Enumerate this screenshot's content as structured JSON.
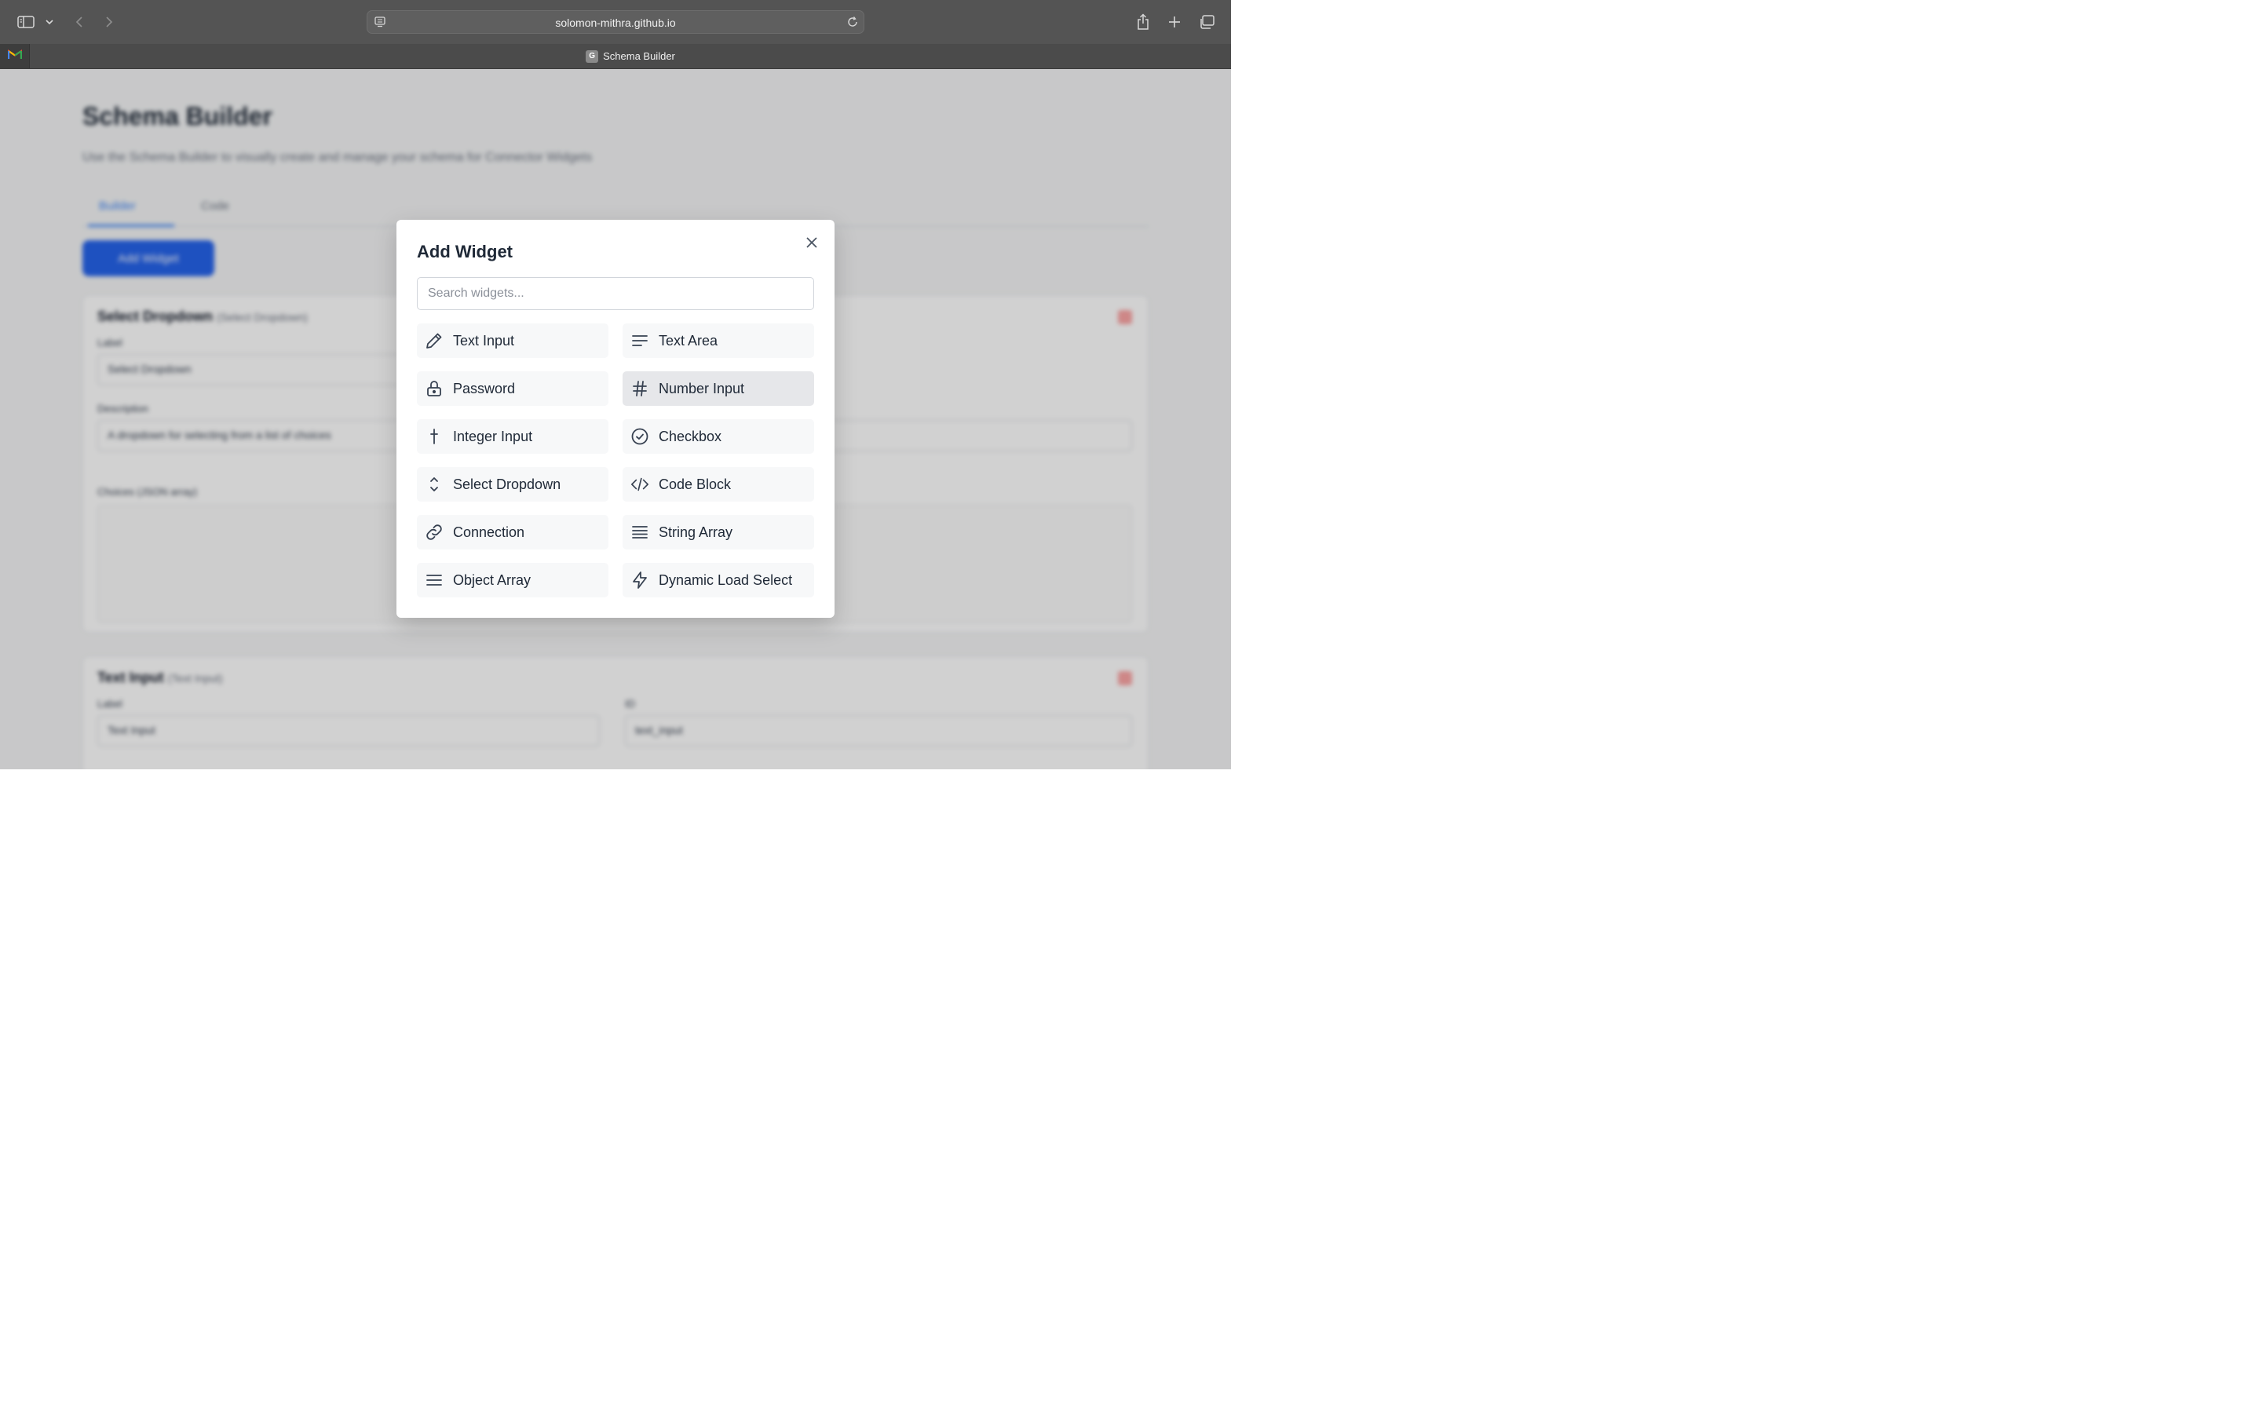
{
  "browser": {
    "url": "solomon-mithra.github.io",
    "tab_title": "Schema Builder",
    "tab_favicon_letter": "G"
  },
  "page": {
    "title": "Schema Builder",
    "subtitle": "Use the Schema Builder to visually create and manage your schema for Connector Widgets",
    "tabs": [
      "Builder",
      "Code"
    ],
    "add_button": "Add Widget",
    "card1": {
      "title": "Select Dropdown",
      "subtitle": "(Select Dropdown)",
      "label_field": "Label",
      "label_value": "Select Dropdown",
      "description_field": "Description",
      "description_value": "A dropdown for selecting from a list of choices",
      "options_field": "Choices (JSON array)"
    },
    "card2": {
      "title": "Text Input",
      "subtitle": "(Text Input)",
      "label_field": "Label",
      "label_value": "Text Input",
      "id_field": "ID",
      "id_value": "text_input"
    }
  },
  "modal": {
    "title": "Add Widget",
    "search_placeholder": "Search widgets...",
    "widgets": [
      {
        "label": "Text Input",
        "icon": "pencil-icon"
      },
      {
        "label": "Text Area",
        "icon": "text-lines-icon"
      },
      {
        "label": "Password",
        "icon": "lock-icon"
      },
      {
        "label": "Number Input",
        "icon": "hash-icon"
      },
      {
        "label": "Integer Input",
        "icon": "plus-icon"
      },
      {
        "label": "Checkbox",
        "icon": "check-circle-icon"
      },
      {
        "label": "Select Dropdown",
        "icon": "chevrons-up-down-icon"
      },
      {
        "label": "Code Block",
        "icon": "code-icon"
      },
      {
        "label": "Connection",
        "icon": "link-icon"
      },
      {
        "label": "String Array",
        "icon": "list-icon"
      },
      {
        "label": "Object Array",
        "icon": "menu-icon"
      },
      {
        "label": "Dynamic Load Select",
        "icon": "lightning-icon"
      }
    ],
    "hovered_item": "Number Input"
  }
}
